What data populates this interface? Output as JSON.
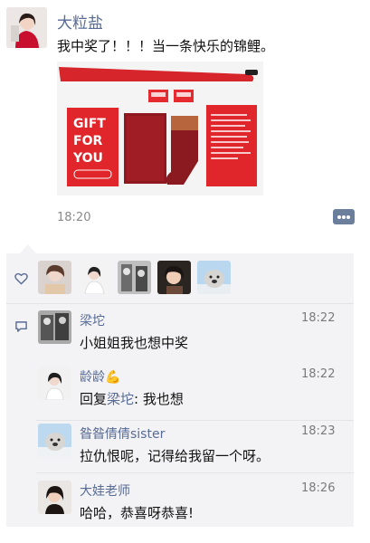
{
  "post": {
    "author": "大粒盐",
    "text": "我中奖了！！！当一条快乐的锦鲤。",
    "time": "18:20",
    "photo_box_text": [
      "GIFT",
      "FOR",
      "YOU"
    ]
  },
  "comments": [
    {
      "name": "梁坨",
      "time": "18:22",
      "text": "小姐姐我也想中奖"
    },
    {
      "name": "龄龄💪",
      "time": "18:22",
      "reply_prefix": "回复",
      "reply_to": "梁坨",
      "reply_text": ": 我也想"
    },
    {
      "name": "昝昝倩倩sister",
      "time": "18:23",
      "text": "拉仇恨呢，记得给我留一个呀。"
    },
    {
      "name": "大娃老师",
      "time": "18:26",
      "text": "哈哈，恭喜呀恭喜!"
    }
  ],
  "icons": {
    "like": "heart-outline-icon",
    "comment": "speech-bubble-icon",
    "more": "more-dots-icon"
  },
  "colors": {
    "link": "#576b95",
    "panel": "#f3f3f5",
    "gift_red": "#e0262a"
  }
}
